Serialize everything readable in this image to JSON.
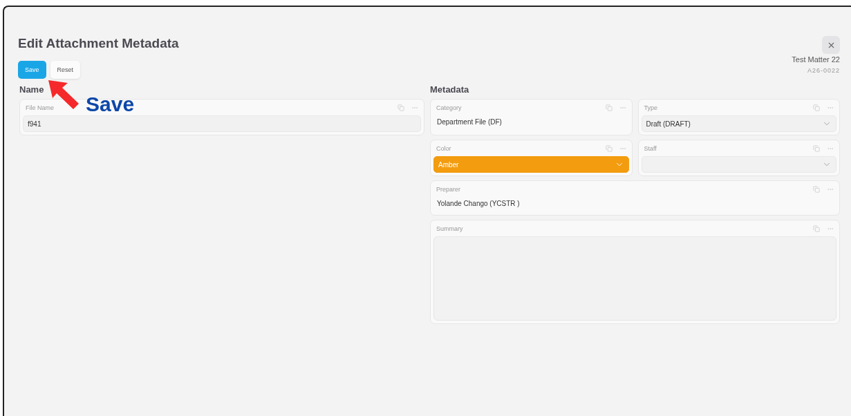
{
  "dialog": {
    "title": "Edit Attachment Metadata",
    "buttons": [
      {
        "label": "Save",
        "kind": "primary"
      },
      {
        "label": "Reset",
        "kind": "secondary"
      }
    ],
    "matter": {
      "name": "Test Matter 22",
      "number": "A26-0022"
    }
  },
  "annotation": {
    "label": "Save"
  },
  "name_section": {
    "heading": "Name",
    "fields": [
      {
        "label": "File Name",
        "kind": "input",
        "value": "f941"
      }
    ]
  },
  "metadata_section": {
    "heading": "Metadata",
    "fields": [
      {
        "label": "Category",
        "kind": "text",
        "value": "Department File (DF)",
        "wide": false
      },
      {
        "label": "Type",
        "kind": "select",
        "value": "Draft (DRAFT)",
        "wide": false
      },
      {
        "label": "Color",
        "kind": "select",
        "value": "Amber",
        "color": "#f39c0f",
        "wide": false
      },
      {
        "label": "Staff",
        "kind": "select",
        "wide": false
      },
      {
        "label": "Preparer",
        "kind": "text",
        "value": "Yolande Chango (YCSTR )",
        "wide": true
      },
      {
        "label": "Summary",
        "kind": "textarea",
        "wide": true
      }
    ]
  }
}
